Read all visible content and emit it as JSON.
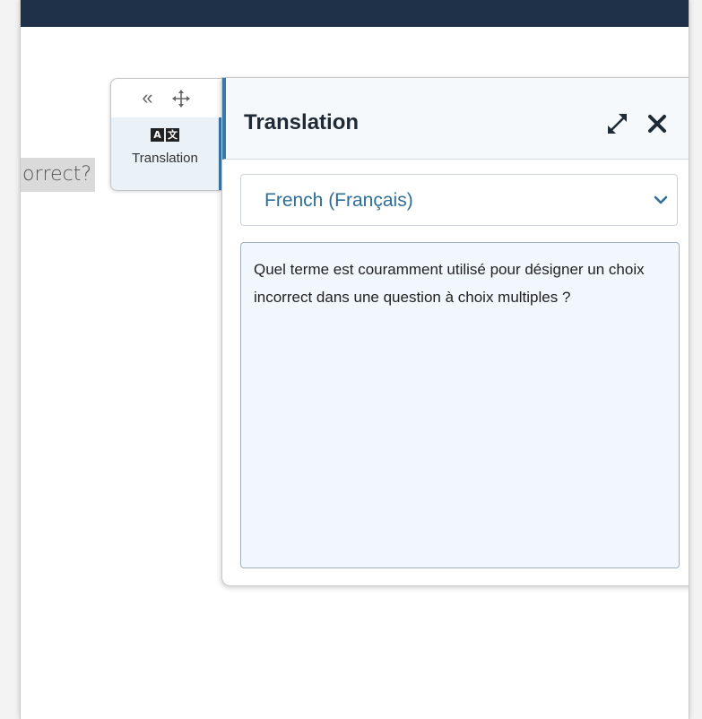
{
  "page": {
    "question_fragment": "orrect?"
  },
  "tool_tab": {
    "collapse_icon": "double-chevron-left-icon",
    "move_icon": "move-arrows-icon",
    "translation_icon": "translate-icon",
    "label": "Translation"
  },
  "panel": {
    "title": "Translation",
    "expand_icon": "expand-icon",
    "close_icon": "close-icon",
    "language_select": {
      "selected": "French (Français)"
    },
    "translated_text": "Quel terme est couramment utilisé pour désigner un choix incorrect dans une question à choix multiples ?"
  },
  "colors": {
    "topbar": "#1e3148",
    "accent": "#3a79a8",
    "select_text": "#2e6e96"
  }
}
